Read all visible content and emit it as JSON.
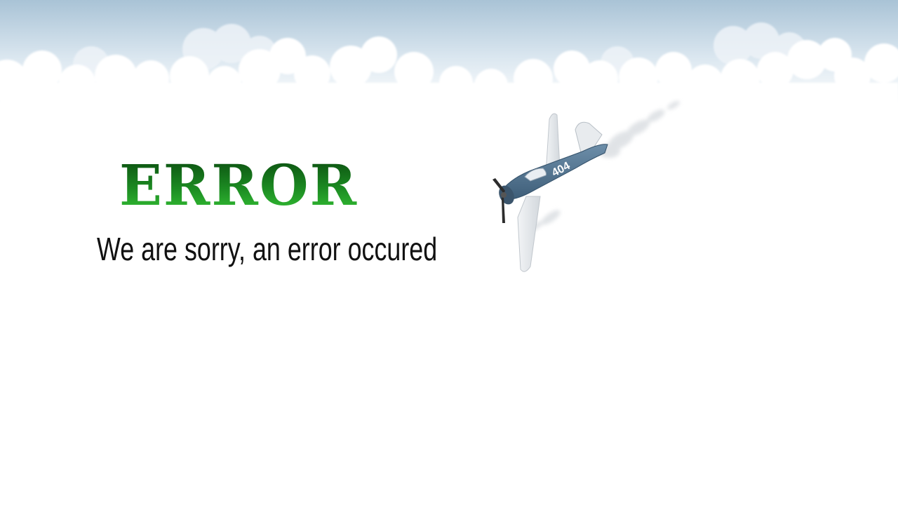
{
  "error": {
    "heading": "ERROR",
    "message": "We are sorry, an error occured",
    "heading_colors": [
      "#0b4d10",
      "#1c8a22",
      "#34c034"
    ]
  },
  "illustration": {
    "plane_marking": "404",
    "plane_color": "#4f7390",
    "icon": "crashing-plane-icon"
  },
  "sky": {
    "colors": [
      "#a9c3d6",
      "#ffffff"
    ]
  }
}
